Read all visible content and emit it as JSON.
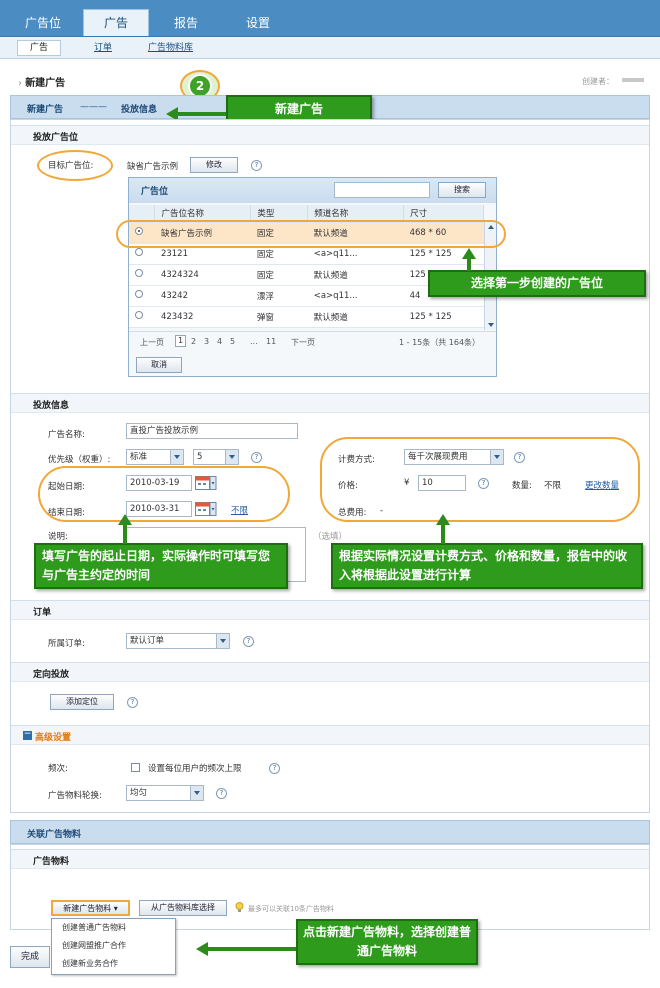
{
  "topnav": {
    "tabs": [
      "广告位",
      "广告",
      "报告",
      "设置"
    ]
  },
  "subnav": {
    "items": [
      "广告",
      "订单",
      "广告物料库"
    ]
  },
  "header": {
    "title": "新建广告",
    "creator_label": "创建者："
  },
  "step": {
    "number": "2",
    "crumb_first": "新建广告",
    "crumb_sep": "———",
    "crumb_second": "投放信息"
  },
  "callouts": {
    "new_ad": "新建广告",
    "select_slot": "选择第一步创建的广告位",
    "dates": "填写广告的起止日期，实际操作时可填写您与广告主约定的时间",
    "pricing": "根据实际情况设置计费方式、价格和数量，报告中的收入将根据此设置进行计算",
    "material": "点击新建广告物料，选择创建普通广告物料"
  },
  "slot_section": {
    "title": "投放广告位",
    "target_label": "目标广告位:",
    "target_value": "缺省广告示例",
    "modify_button": "修改",
    "picker_title": "广告位",
    "search_button": "搜索",
    "columns": [
      "广告位名称",
      "类型",
      "频道名称",
      "尺寸"
    ],
    "rows": [
      [
        "缺省广告示例",
        "固定",
        "默认频道",
        "468 * 60"
      ],
      [
        "23121",
        "固定",
        "<a>q11...",
        "125 * 125"
      ],
      [
        "4324324",
        "固定",
        "默认频道",
        "125"
      ],
      [
        "43242",
        "漂浮",
        "<a>q11...",
        "44"
      ],
      [
        "423432",
        "弹窗",
        "默认频道",
        "125 * 125"
      ]
    ],
    "pager": {
      "prev": "上一页",
      "pages": [
        "1",
        "2",
        "3",
        "4",
        "5",
        "...",
        "11"
      ],
      "next": "下一页",
      "summary": "1 - 15条（共 164条）"
    },
    "cancel_button": "取消"
  },
  "info_section": {
    "title": "投放信息",
    "name_label": "广告名称:",
    "name_value": "直投广告投放示例",
    "priority_label": "优先级（权重）:",
    "priority_value": "标准",
    "weight_value": "5",
    "start_label": "起始日期:",
    "start_value": "2010-03-19",
    "end_label": "结束日期:",
    "end_value": "2010-03-31",
    "unlimited_link": "不限",
    "desc_label": "说明:",
    "desc_hint": "（选填）",
    "billing_label": "计费方式:",
    "billing_value": "每千次展现费用",
    "price_label": "价格:",
    "price_currency": "¥",
    "price_value": "10",
    "qty_label": "数量:",
    "qty_value": "不限",
    "change_qty_link": "更改数量",
    "total_label": "总费用:",
    "total_value": "-"
  },
  "order_section": {
    "title": "订单",
    "label": "所属订单:",
    "value": "默认订单"
  },
  "targeting_section": {
    "title": "定向投放",
    "add_button": "添加定位"
  },
  "advanced_section": {
    "title": "高级设置",
    "freq_label": "频次:",
    "freq_checkbox": "设置每位用户的频次上限",
    "rotate_label": "广告物料轮换:",
    "rotate_value": "均匀"
  },
  "material_section": {
    "bar_title": "关联广告物料",
    "title": "广告物料",
    "new_button": "新建广告物料",
    "from_lib_button": "从广告物料库选择",
    "tip": "最多可以关联10条广告物料",
    "menu": [
      "创建普通广告物料",
      "创建网盟推广合作",
      "创建新业务合作"
    ]
  },
  "footer": {
    "finish_button": "完成"
  },
  "colors": {
    "nav": "#4b8dc3",
    "callout": "#2f9b1c",
    "ring": "#f0a838"
  }
}
